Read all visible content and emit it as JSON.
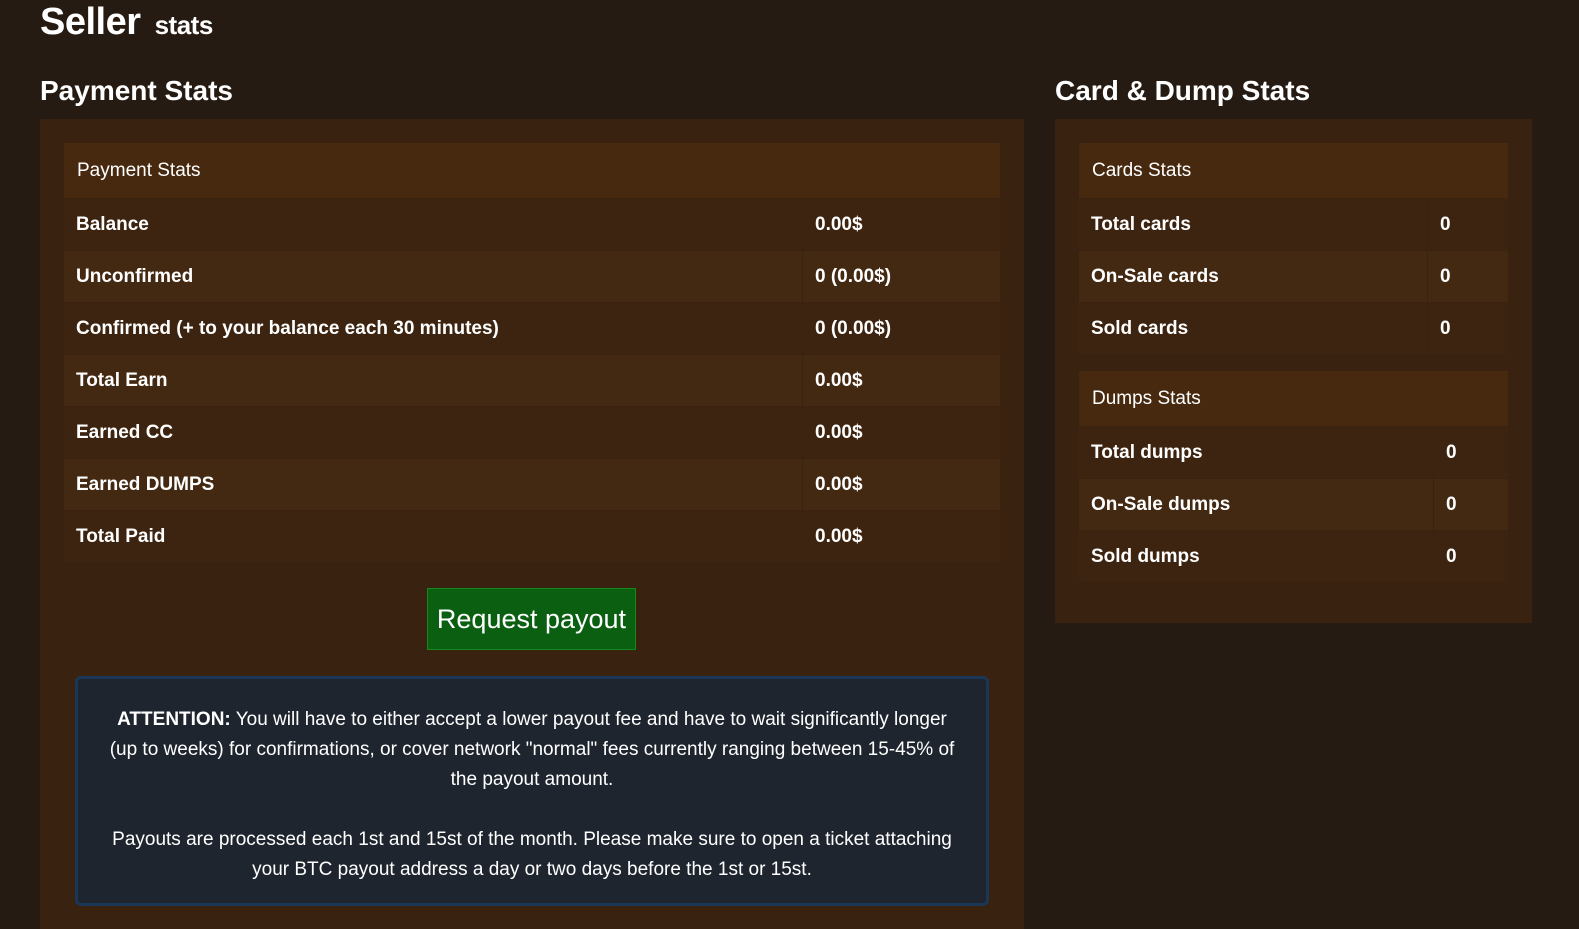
{
  "page": {
    "title": "Seller",
    "subtitle": "stats"
  },
  "payment_section": {
    "heading": "Payment Stats",
    "table_header": "Payment Stats",
    "rows": [
      {
        "label": "Balance",
        "value": "0.00$"
      },
      {
        "label": "Unconfirmed",
        "value": "0 (0.00$)"
      },
      {
        "label": "Confirmed (+ to your balance each 30 minutes)",
        "value": "0 (0.00$)"
      },
      {
        "label": "Total Earn",
        "value": "0.00$"
      },
      {
        "label": "Earned CC",
        "value": "0.00$"
      },
      {
        "label": "Earned DUMPS",
        "value": "0.00$"
      },
      {
        "label": "Total Paid",
        "value": "0.00$"
      }
    ],
    "payout_button": "Request payout",
    "notice": {
      "attention_label": "ATTENTION:",
      "attention_text": " You will have to either accept a lower payout fee and have to wait significantly longer (up to weeks) for confirmations, or cover network \"normal\" fees currently ranging between 15-45% of the payout amount.",
      "schedule_text": "Payouts are processed each 1st and 15st of the month. Please make sure to open a ticket attaching your BTC payout address a day or two days before the 1st or 15st."
    }
  },
  "card_dump_section": {
    "heading": "Card & Dump Stats",
    "cards": {
      "header": "Cards Stats",
      "rows": [
        {
          "label": "Total cards",
          "value": "0"
        },
        {
          "label": "On-Sale cards",
          "value": "0"
        },
        {
          "label": "Sold cards",
          "value": "0"
        }
      ]
    },
    "dumps": {
      "header": "Dumps Stats",
      "rows": [
        {
          "label": "Total dumps",
          "value": "0"
        },
        {
          "label": "On-Sale dumps",
          "value": "0"
        },
        {
          "label": "Sold dumps",
          "value": "0"
        }
      ]
    }
  },
  "colors": {
    "background": "#261b12",
    "panel": "#3a2211",
    "table_header": "#47290f",
    "payout_button": "#0a5f10",
    "notice_background": "#1f252e",
    "notice_border": "#1b3756"
  }
}
